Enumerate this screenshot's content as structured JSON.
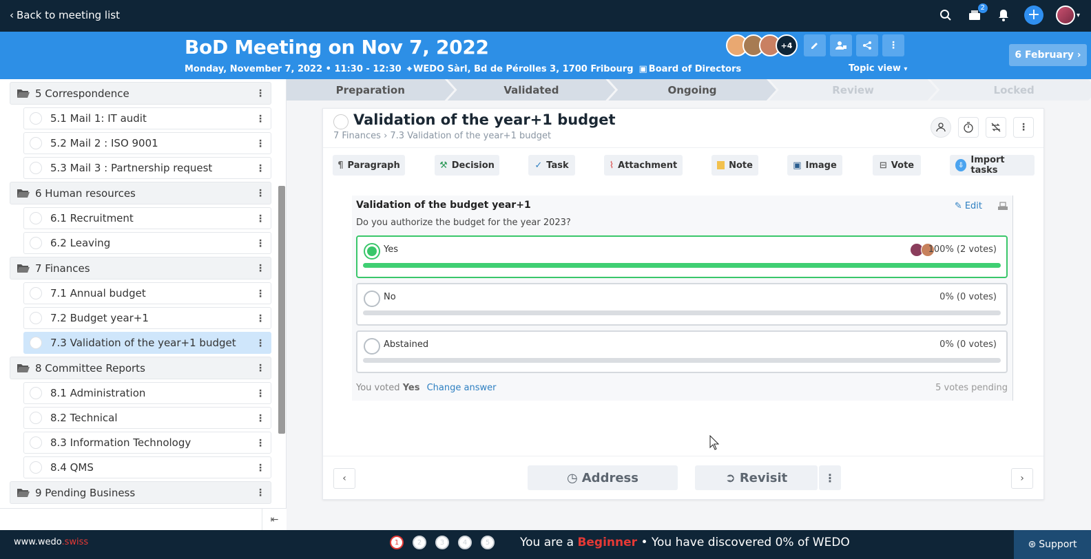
{
  "topbar": {
    "back_label": "Back to meeting list",
    "notifications_count": "2"
  },
  "meeting": {
    "title": "BoD Meeting on Nov 7, 2022",
    "datetime": "Monday, November 7, 2022 • 11:30 - 12:30",
    "location": "WEDO Sàrl, Bd de Pérolles 3, 1700 Fribourg",
    "group": "Board of Directors",
    "attendees_more": "+4",
    "topic_view_label": "Topic view",
    "next_meeting_label": "6 February"
  },
  "sidebar": {
    "sections": [
      {
        "label": "5 Correspondence",
        "items": [
          "5.1 Mail 1: IT audit",
          "5.2 Mail 2 : ISO 9001",
          "5.3 Mail 3 : Partnership request"
        ]
      },
      {
        "label": "6 Human resources",
        "items": [
          "6.1 Recruitment",
          "6.2 Leaving"
        ]
      },
      {
        "label": "7 Finances",
        "items": [
          "7.1 Annual budget",
          "7.2 Budget year+1",
          "7.3 Validation of the year+1 budget"
        ]
      },
      {
        "label": "8 Committee Reports",
        "items": [
          "8.1 Administration",
          "8.2 Technical",
          "8.3 Information Technology",
          "8.4 QMS"
        ]
      },
      {
        "label": "9 Pending Business",
        "items": []
      }
    ],
    "active_item": "7.3 Validation of the year+1 budget"
  },
  "steps": [
    "Preparation",
    "Validated",
    "Ongoing",
    "Review",
    "Locked"
  ],
  "topic": {
    "title": "Validation of the year+1 budget",
    "breadcrumb_section": "7 Finances",
    "breadcrumb_topic": "7.3 Validation of the year+1 budget"
  },
  "blocks": {
    "paragraph": "Paragraph",
    "decision": "Decision",
    "task": "Task",
    "attachment": "Attachment",
    "note": "Note",
    "image": "Image",
    "vote": "Vote",
    "import_tasks": "Import tasks"
  },
  "vote": {
    "title": "Validation of the budget year+1",
    "edit_label": "Edit",
    "question": "Do you authorize the budget for the year 2023?",
    "options": [
      {
        "label": "Yes",
        "result": "100% (2 votes)",
        "percent": 100,
        "selected": true
      },
      {
        "label": "No",
        "result": "0% (0 votes)",
        "percent": 0,
        "selected": false
      },
      {
        "label": "Abstained",
        "result": "0% (0 votes)",
        "percent": 0,
        "selected": false
      }
    ],
    "you_voted_prefix": "You voted",
    "you_voted_value": "Yes",
    "change_answer": "Change answer",
    "pending": "5 votes pending"
  },
  "actions": {
    "address": "Address",
    "revisit": "Revisit"
  },
  "footer": {
    "site_main": "www.wedo",
    "site_tld": ".swiss",
    "dots": [
      "1",
      "2",
      "3",
      "4",
      "5"
    ],
    "msg_prefix": "You are a",
    "level": "Beginner",
    "msg_suffix": "• You have discovered 0% of WEDO",
    "support": "Support"
  }
}
